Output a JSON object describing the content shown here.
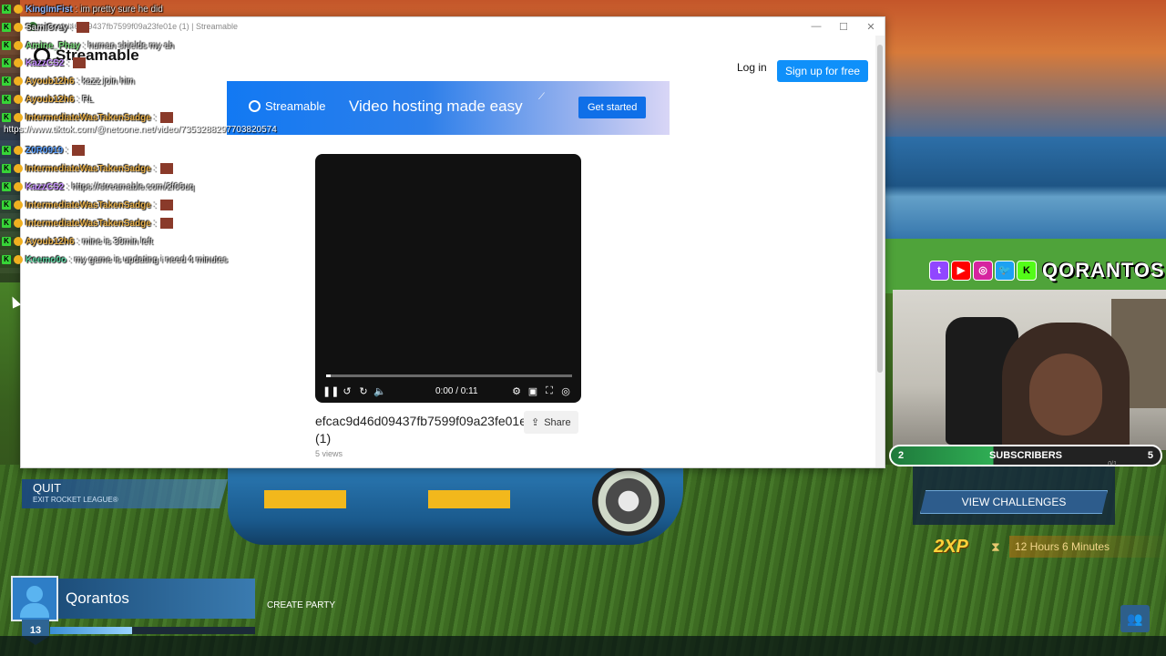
{
  "browser": {
    "title": "efcac9d46d09437fb7599f09a23fe01e (1) | Streamable",
    "controls": [
      "—",
      "☐",
      "✕"
    ]
  },
  "streamable": {
    "logo": "Streamable",
    "login": "Log in",
    "signup": "Sign up for free",
    "banner": {
      "logo": "Streamable",
      "tagline": "Video hosting made easy",
      "cta": "Get started"
    },
    "player": {
      "time": "0:00 / 0:11",
      "progress": 0.02
    },
    "video_title": "efcac9d46d09437fb7599f09a23fe01e (1)",
    "views": "5 views",
    "share": "Share"
  },
  "chat": [
    {
      "user": "KingImFist",
      "msg": ": im pretty sure he did",
      "color": "#8fb8ff"
    },
    {
      "user": "SamiCrey",
      "msg": ":",
      "color": "#d8d8d8"
    },
    {
      "user": "Amine_Phay",
      "msg": ": human shields my ah",
      "color": "#7ee07e"
    },
    {
      "user": "KazzCS2",
      "msg": ":",
      "color": "#c58cff"
    },
    {
      "user": "Ayoub12h6",
      "msg": ": kazz join him",
      "color": "#e8b04a"
    },
    {
      "user": "Ayoub12h6",
      "msg": ": RL",
      "color": "#e8b04a"
    },
    {
      "user": "IntermediateWasTakenSadge",
      "msg": ":",
      "color": "#e8b04a"
    },
    {
      "user": "Z0R0919",
      "msg": ":",
      "color": "#5aa0ff"
    },
    {
      "user": "IntermediateWasTakenSadge",
      "msg": ":",
      "color": "#e8b04a"
    },
    {
      "user": "KazzCS2",
      "msg": ": https://streamable.com/2f06uq",
      "color": "#c58cff"
    },
    {
      "user": "IntermediateWasTakenSadge",
      "msg": ":",
      "color": "#e8b04a"
    },
    {
      "user": "IntermediateWasTakenSadge",
      "msg": ":",
      "color": "#e8b04a"
    },
    {
      "user": "Ayoub12h6",
      "msg": ": mine is 30min left",
      "color": "#e8b04a"
    },
    {
      "user": "Keemo0o",
      "msg": ": my game is updating i need 4 minutes",
      "color": "#5ad4a0"
    }
  ],
  "chat_url": "https://www.tiktok.com/@netoone.net/video/7353288297703820574",
  "hud": {
    "quit": "QUIT",
    "quit_sub": "EXIT ROCKET LEAGUE®",
    "player_name": "Qorantos",
    "level": "13",
    "xp_progress": 0.4,
    "create_party": "CREATE PARTY",
    "view_challenges": "VIEW CHALLENGES",
    "xp_badge": "2XP",
    "xp_timer": "12 Hours 6 Minutes"
  },
  "overlay": {
    "brand": "QORANTOS",
    "subs_left": "2",
    "subs_label": "SUBSCRIBERS",
    "subs_right": "5",
    "subs_progress": "0/1"
  }
}
